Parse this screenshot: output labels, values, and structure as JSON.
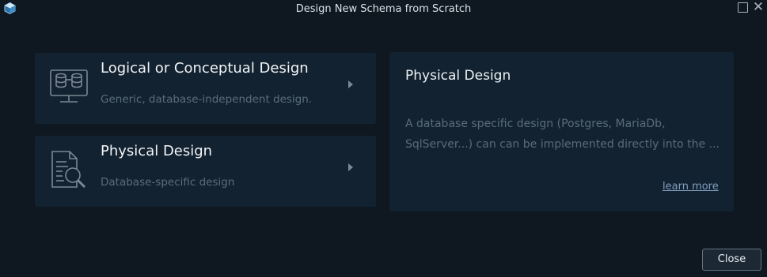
{
  "window": {
    "title": "Design New Schema from Scratch",
    "close_glyph": "✕"
  },
  "options": [
    {
      "title": "Logical or Conceptual Design",
      "description": "Generic, database-independent design.",
      "icon": "monitor-database-icon"
    },
    {
      "title": "Physical Design",
      "description": "Database-specific design",
      "icon": "document-search-icon"
    }
  ],
  "detail": {
    "title": "Physical Design",
    "description_lines": [
      "A database specific design (Postgres, MariaDb,",
      "SqlServer...) can can be implemented directly into the ..."
    ],
    "learn_more": "learn more"
  },
  "footer": {
    "close_label": "Close"
  },
  "colors": {
    "background": "#0f1821",
    "card": "#132230",
    "link": "#7f9fc0"
  }
}
